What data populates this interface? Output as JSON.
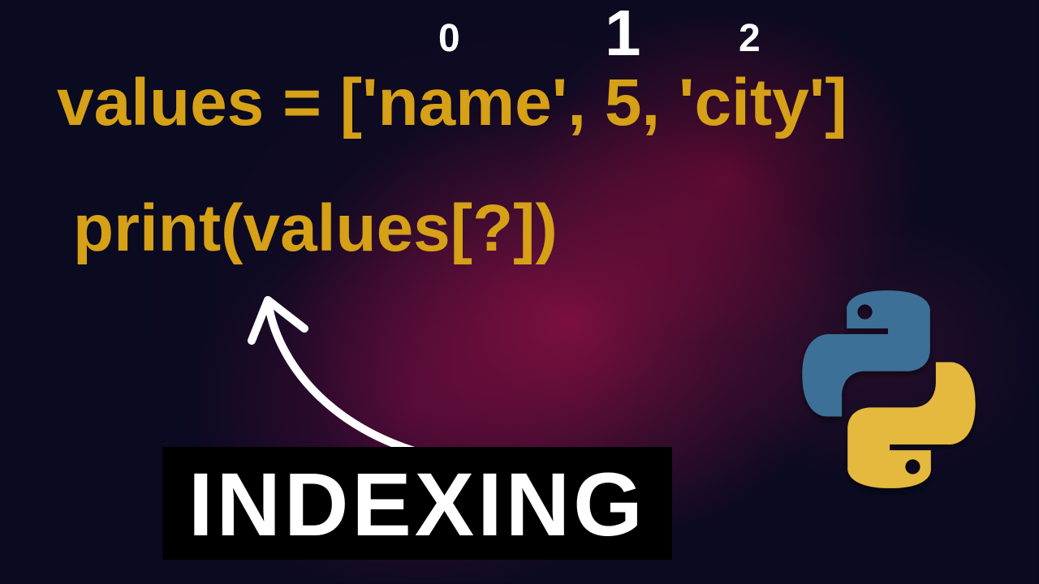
{
  "indices": {
    "i0": "0",
    "i1": "1",
    "i2": "2"
  },
  "code": {
    "line1": "values =  ['name', 5, 'city']",
    "line2": "print(values[?])"
  },
  "title": "INDEXING",
  "colors": {
    "code_yellow": "#d6a017",
    "bg_dark": "#0a0a20",
    "smoke_magenta": "#a01046",
    "python_blue": "#3d6f97",
    "python_yellow": "#e5b93c"
  }
}
